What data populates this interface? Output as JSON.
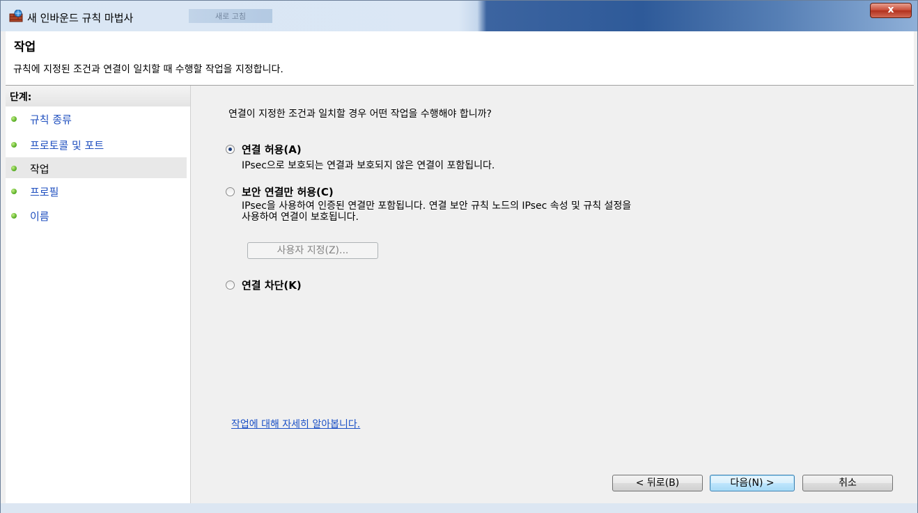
{
  "window": {
    "title": "새 인바운드 규칙 마법사",
    "background_tab": "새로 고침",
    "close_label": "x"
  },
  "header": {
    "title": "작업",
    "description": "규칙에 지정된 조건과 연결이 일치할 때 수행할 작업을 지정합니다."
  },
  "steps": {
    "heading": "단계:",
    "items": [
      {
        "label": "규칙 종류"
      },
      {
        "label": "프로토콜 및 포트"
      },
      {
        "label": "작업"
      },
      {
        "label": "프로필"
      },
      {
        "label": "이름"
      }
    ],
    "current_index": 2
  },
  "main": {
    "question": "연결이 지정한 조건과 일치할 경우 어떤 작업을 수행해야 합니까?",
    "options": [
      {
        "label": "연결 허용(A)",
        "description": "IPsec으로 보호되는 연결과 보호되지 않은 연결이 포함됩니다.",
        "checked": true
      },
      {
        "label": "보안 연결만 허용(C)",
        "description_line1": "IPsec을 사용하여 인증된 연결만 포함됩니다. 연결 보안 규칙 노드의 IPsec 속성 및 규칙 설정을",
        "description_line2": "사용하여 연결이 보호됩니다.",
        "checked": false
      },
      {
        "label": "연결 차단(K)",
        "checked": false
      }
    ],
    "customize_button": "사용자 지정(Z)...",
    "learn_link": "작업에 대해 자세히 알아봅니다."
  },
  "footer": {
    "back_button": "< 뒤로(B)",
    "next_button": "다음(N) >",
    "cancel_button": "취소"
  },
  "colors": {
    "link": "#1a4fc6",
    "step_link": "#1f4fbf",
    "step_dot": "#5fb32a",
    "close_button": "#c74a36"
  }
}
